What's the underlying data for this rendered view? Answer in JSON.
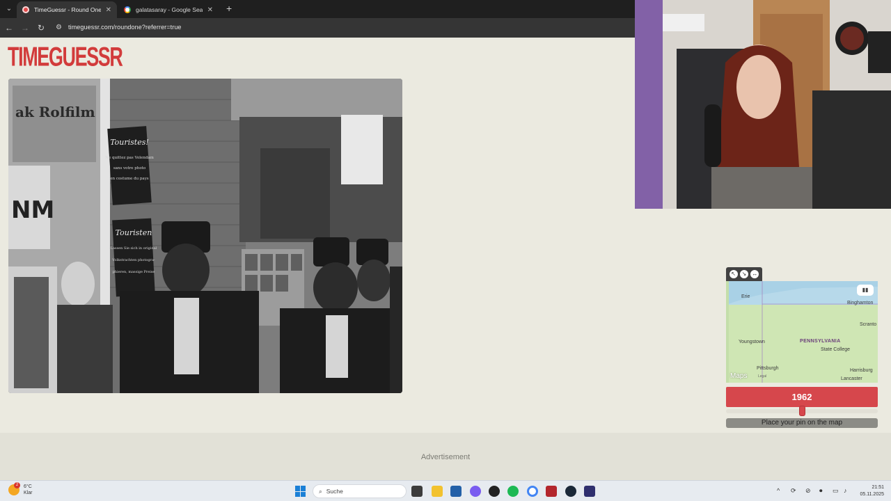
{
  "browser": {
    "tabs": [
      {
        "label": "TimeGuessr - Round One",
        "active": true
      },
      {
        "label": "galatasaray - Google Search",
        "active": false
      }
    ],
    "url": "timeguessr.com/roundone?referrer=true"
  },
  "page": {
    "logo": "TIMEGUESSR",
    "photo_signs": {
      "shop_sign": "ak Rolfilm",
      "sign_top_title": "Touristes!",
      "sign_top_lines": [
        "Ne quittez pas Volendam",
        "sans votre photo",
        "en costume du pays"
      ],
      "sign_mid_title": "Touristen",
      "sign_mid_lines": [
        "Lassen Sie sich in original",
        "Volkstrachten photogra-",
        "phieren, massige Preise"
      ],
      "left_letters": "NM"
    }
  },
  "map": {
    "labels": [
      "Erie",
      "Binghamton",
      "Scranto",
      "Youngstown",
      "PENNSYLVANIA",
      "State College",
      "Pittsburgh",
      "Harrisburg",
      "Lancaster"
    ],
    "brand": "Maps",
    "legal": "Legal",
    "tool_icons": [
      "zoom-in-icon",
      "zoom-out-icon",
      "reset-icon"
    ],
    "layers_icon": "map-layers-icon"
  },
  "controls": {
    "year": "1962",
    "slider_fraction": 0.5,
    "guess_button": "Place your pin on the map"
  },
  "ad": {
    "label": "Advertisement"
  },
  "taskbar": {
    "temperature": "6°C",
    "condition": "Klar",
    "weather_badge": "2",
    "search_placeholder": "Suche",
    "time": "21:51",
    "date": "05.11.2025"
  },
  "colors": {
    "accent": "#d6474c",
    "page_bg": "#ebeae0",
    "logo": "#d23b3b"
  }
}
